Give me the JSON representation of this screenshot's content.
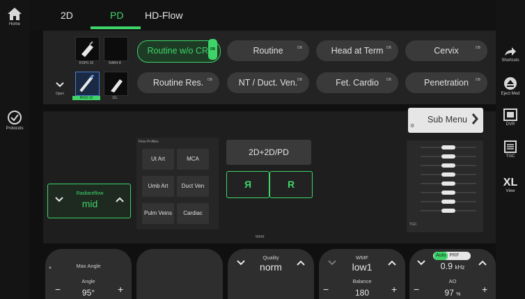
{
  "tabs": [
    "2D",
    "PD",
    "HD-Flow"
  ],
  "left_rail": {
    "home_label": "Home",
    "protocols_label": "Protocols"
  },
  "right_rail": {
    "shortcuts_label": "Shortcuts",
    "eject_label": "Eject Med",
    "dvr_label": "DVR",
    "tgc_label": "TGC",
    "view_label": "View",
    "view_value": "XL"
  },
  "probes": [
    {
      "label": "RSP6-16"
    },
    {
      "label": "RAB4-8"
    },
    {
      "label": "RIC6-12"
    },
    {
      "label": "11L"
    }
  ],
  "probe_open_label": "Open",
  "presets": [
    {
      "label": "Routine w/o CRI",
      "badge": "OB",
      "active": true
    },
    {
      "label": "Routine",
      "badge": "OB"
    },
    {
      "label": "Head at Term",
      "badge": "OB"
    },
    {
      "label": "Cervix",
      "badge": "OB"
    },
    {
      "label": "Routine Res.",
      "badge": "OB"
    },
    {
      "label": "NT / Duct. Ven.",
      "badge": "OB"
    },
    {
      "label": "Fet. Cardio",
      "badge": "OB"
    },
    {
      "label": "Penetration",
      "badge": "OB"
    }
  ],
  "sub_menu": {
    "label": "Sub Menu"
  },
  "flow_profiles": {
    "title": "Flow Profiles",
    "items": [
      "Ut Art",
      "MCA",
      "Umb Art",
      "Duct Ven",
      "Pulm Veins",
      "Cardiac"
    ]
  },
  "mode_button": {
    "label": "2D+2D/PD"
  },
  "flip_buttons": {
    "left": "Я",
    "right": "R"
  },
  "radiantflow": {
    "label": "Radiantflow",
    "value": "mid"
  },
  "main_label": "MAIN",
  "tgc_label": "TGC",
  "tgc_levels": [
    0.5,
    0.5,
    0.5,
    0.5,
    0.5,
    0.5,
    0.5,
    0.5
  ],
  "bottom": {
    "max_angle": {
      "label": "Max Angle",
      "sub_label": "Angle",
      "value": "95°"
    },
    "quality": {
      "label": "Quality",
      "value": "norm"
    },
    "wmf": {
      "label": "WMF",
      "value": "low1",
      "sub_label": "Balance",
      "sub_value": "180"
    },
    "prf": {
      "auto": "Auto",
      "label": "PRF",
      "value": "0.9",
      "unit": "kHz",
      "sub_label": "AO",
      "sub_value": "97",
      "sub_unit": "%"
    }
  },
  "colors": {
    "accent": "#3fd46a",
    "panel": "#232323",
    "button": "#3a3a3a"
  }
}
